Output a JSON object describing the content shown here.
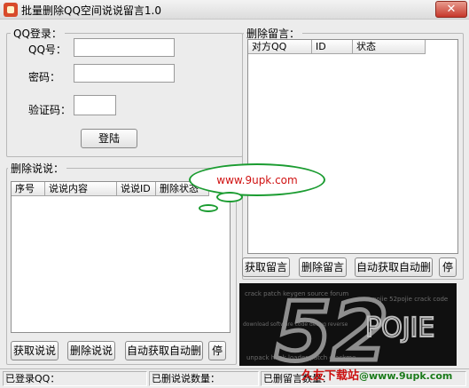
{
  "window": {
    "title": "批量删除QQ空间说说留言1.0",
    "close_glyph": "✕"
  },
  "login": {
    "group_label": "QQ登录：",
    "qq_label": "QQ号：",
    "password_label": "密码：",
    "captcha_label": "验证码：",
    "qq_value": "",
    "password_value": "",
    "captcha_value": "",
    "login_button": "登陆"
  },
  "shuoshuo": {
    "group_label": "删除说说：",
    "columns": [
      "序号",
      "说说内容",
      "说说ID",
      "删除状态"
    ],
    "buttons": {
      "fetch": "获取说说",
      "delete": "删除说说",
      "auto": "自动获取自动删",
      "stop": "停"
    }
  },
  "messages": {
    "group_label": "删除留言：",
    "columns": [
      "对方QQ",
      "ID",
      "状态"
    ],
    "buttons": {
      "fetch": "获取留言",
      "delete": "删除留言",
      "auto": "自动获取自动删",
      "stop": "停"
    }
  },
  "ad_bubble": {
    "text": "www.9upk.com"
  },
  "banner": {
    "big_text": "52",
    "small_text": "POJIE"
  },
  "status": {
    "logged_in": "已登录QQ：",
    "deleted_shuoshuo": "已删说说数量：",
    "deleted_messages": "已删留言数量："
  },
  "watermark": {
    "text": "久友下载站",
    "url": "@www.9upk.com"
  }
}
